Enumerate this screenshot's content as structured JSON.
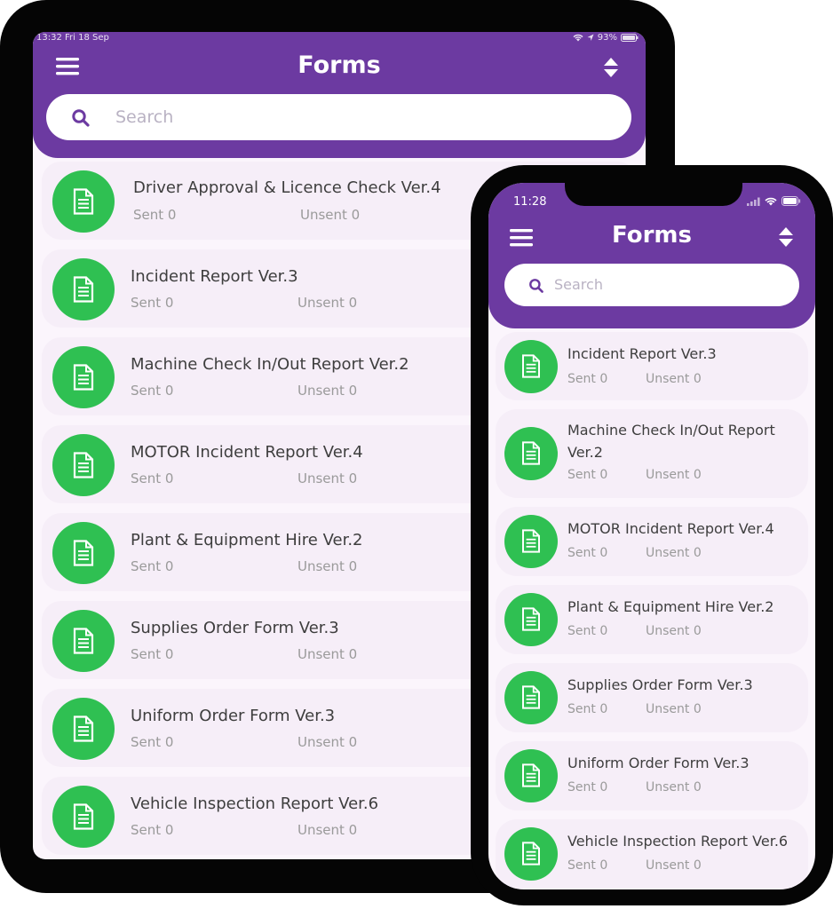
{
  "tablet": {
    "status": {
      "time": "13:32",
      "date": "Fri 18 Sep",
      "battery": "93%"
    },
    "title": "Forms",
    "search_placeholder": "Search",
    "forms": [
      {
        "name": "Driver Approval & Licence Check Ver.4",
        "sent": "Sent 0",
        "unsent": "Unsent 0"
      },
      {
        "name": "Incident Report Ver.3",
        "sent": "Sent 0",
        "unsent": "Unsent 0"
      },
      {
        "name": "Machine Check In/Out Report Ver.2",
        "sent": "Sent 0",
        "unsent": "Unsent 0"
      },
      {
        "name": "MOTOR Incident Report Ver.4",
        "sent": "Sent 0",
        "unsent": "Unsent 0"
      },
      {
        "name": "Plant & Equipment Hire Ver.2",
        "sent": "Sent 0",
        "unsent": "Unsent 0"
      },
      {
        "name": "Supplies Order Form Ver.3",
        "sent": "Sent 0",
        "unsent": "Unsent 0"
      },
      {
        "name": "Uniform Order Form Ver.3",
        "sent": "Sent 0",
        "unsent": "Unsent 0"
      },
      {
        "name": "Vehicle Inspection Report Ver.6",
        "sent": "Sent 0",
        "unsent": "Unsent 0"
      }
    ]
  },
  "phone": {
    "status": {
      "time": "11:28"
    },
    "title": "Forms",
    "search_placeholder": "Search",
    "forms": [
      {
        "name": "Incident Report Ver.3",
        "sent": "Sent 0",
        "unsent": "Unsent 0"
      },
      {
        "name": "Machine Check In/Out Report Ver.2",
        "sent": "Sent 0",
        "unsent": "Unsent 0"
      },
      {
        "name": "MOTOR Incident Report Ver.4",
        "sent": "Sent 0",
        "unsent": "Unsent 0"
      },
      {
        "name": "Plant & Equipment Hire Ver.2",
        "sent": "Sent 0",
        "unsent": "Unsent 0"
      },
      {
        "name": "Supplies Order Form Ver.3",
        "sent": "Sent 0",
        "unsent": "Unsent 0"
      },
      {
        "name": "Uniform Order Form Ver.3",
        "sent": "Sent 0",
        "unsent": "Unsent 0"
      },
      {
        "name": "Vehicle Inspection Report Ver.6",
        "sent": "Sent 0",
        "unsent": "Unsent 0"
      }
    ]
  },
  "colors": {
    "header_purple": "#6c3aa1",
    "icon_green": "#2fc052",
    "card_background": "#f6eef8",
    "search_icon": "#6c3aa1"
  },
  "icons": {
    "menu": "hamburger-menu-icon",
    "sort": "sort-icon",
    "search": "search-icon",
    "form": "document-icon"
  }
}
